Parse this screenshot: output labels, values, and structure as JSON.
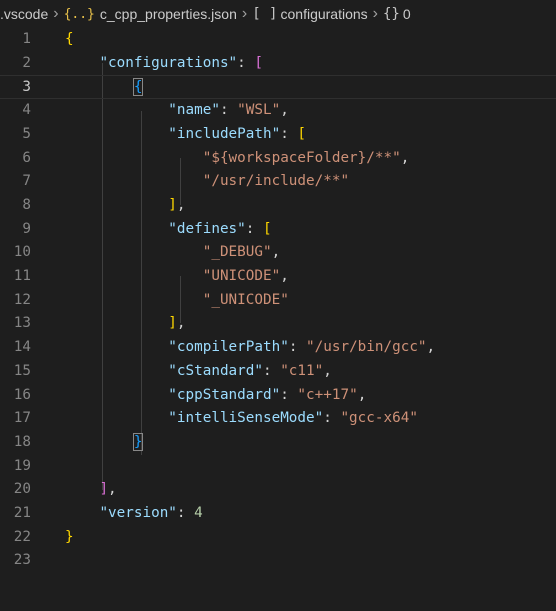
{
  "breadcrumb": {
    "folder": ".vscode",
    "file_icon": "{..}",
    "file": "c_cpp_properties.json",
    "array_icon": "[ ]",
    "array_label": "configurations",
    "object_icon": "{}",
    "object_label": "0"
  },
  "editor": {
    "current_line": 3,
    "lines": [
      {
        "n": "1",
        "tokens": [
          {
            "t": "{",
            "c": "br1"
          }
        ]
      },
      {
        "n": "2",
        "tokens": [
          {
            "t": "    "
          },
          {
            "t": "\"configurations\"",
            "c": "key"
          },
          {
            "t": ": "
          },
          {
            "t": "[",
            "c": "br2"
          }
        ]
      },
      {
        "n": "3",
        "tokens": [
          {
            "t": "        "
          },
          {
            "t": "{",
            "c": "br3 bracket-box"
          }
        ]
      },
      {
        "n": "4",
        "tokens": [
          {
            "t": "            "
          },
          {
            "t": "\"name\"",
            "c": "key"
          },
          {
            "t": ": "
          },
          {
            "t": "\"WSL\"",
            "c": "str"
          },
          {
            "t": ","
          }
        ]
      },
      {
        "n": "5",
        "tokens": [
          {
            "t": "            "
          },
          {
            "t": "\"includePath\"",
            "c": "key"
          },
          {
            "t": ": "
          },
          {
            "t": "[",
            "c": "br1"
          }
        ]
      },
      {
        "n": "6",
        "tokens": [
          {
            "t": "                "
          },
          {
            "t": "\"${workspaceFolder}/**\"",
            "c": "str"
          },
          {
            "t": ","
          }
        ]
      },
      {
        "n": "7",
        "tokens": [
          {
            "t": "                "
          },
          {
            "t": "\"/usr/include/**\"",
            "c": "str"
          }
        ]
      },
      {
        "n": "8",
        "tokens": [
          {
            "t": "            "
          },
          {
            "t": "]",
            "c": "br1"
          },
          {
            "t": ","
          }
        ]
      },
      {
        "n": "9",
        "tokens": [
          {
            "t": "            "
          },
          {
            "t": "\"defines\"",
            "c": "key"
          },
          {
            "t": ": "
          },
          {
            "t": "[",
            "c": "br1"
          }
        ]
      },
      {
        "n": "10",
        "tokens": [
          {
            "t": "                "
          },
          {
            "t": "\"_DEBUG\"",
            "c": "str"
          },
          {
            "t": ","
          }
        ]
      },
      {
        "n": "11",
        "tokens": [
          {
            "t": "                "
          },
          {
            "t": "\"UNICODE\"",
            "c": "str"
          },
          {
            "t": ","
          }
        ]
      },
      {
        "n": "12",
        "tokens": [
          {
            "t": "                "
          },
          {
            "t": "\"_UNICODE\"",
            "c": "str"
          }
        ]
      },
      {
        "n": "13",
        "tokens": [
          {
            "t": "            "
          },
          {
            "t": "]",
            "c": "br1"
          },
          {
            "t": ","
          }
        ]
      },
      {
        "n": "14",
        "tokens": [
          {
            "t": "            "
          },
          {
            "t": "\"compilerPath\"",
            "c": "key"
          },
          {
            "t": ": "
          },
          {
            "t": "\"/usr/bin/gcc\"",
            "c": "str"
          },
          {
            "t": ","
          }
        ]
      },
      {
        "n": "15",
        "tokens": [
          {
            "t": "            "
          },
          {
            "t": "\"cStandard\"",
            "c": "key"
          },
          {
            "t": ": "
          },
          {
            "t": "\"c11\"",
            "c": "str"
          },
          {
            "t": ","
          }
        ]
      },
      {
        "n": "16",
        "tokens": [
          {
            "t": "            "
          },
          {
            "t": "\"cppStandard\"",
            "c": "key"
          },
          {
            "t": ": "
          },
          {
            "t": "\"c++17\"",
            "c": "str"
          },
          {
            "t": ","
          }
        ]
      },
      {
        "n": "17",
        "tokens": [
          {
            "t": "            "
          },
          {
            "t": "\"intelliSenseMode\"",
            "c": "key"
          },
          {
            "t": ": "
          },
          {
            "t": "\"gcc-x64\"",
            "c": "str"
          }
        ]
      },
      {
        "n": "18",
        "tokens": [
          {
            "t": "        "
          },
          {
            "t": "}",
            "c": "br3 bracket-box"
          }
        ]
      },
      {
        "n": "19",
        "tokens": []
      },
      {
        "n": "20",
        "tokens": [
          {
            "t": "    "
          },
          {
            "t": "]",
            "c": "br2"
          },
          {
            "t": ","
          }
        ]
      },
      {
        "n": "21",
        "tokens": [
          {
            "t": "    "
          },
          {
            "t": "\"version\"",
            "c": "key"
          },
          {
            "t": ": "
          },
          {
            "t": "4",
            "c": "num"
          }
        ]
      },
      {
        "n": "22",
        "tokens": [
          {
            "t": "}",
            "c": "br1"
          }
        ]
      },
      {
        "n": "23",
        "tokens": []
      }
    ]
  },
  "colors": {
    "background": "#1e1e1e",
    "key": "#9cdcfe",
    "string": "#ce9178",
    "number": "#b5cea8",
    "bracket_level1": "#ffd700",
    "bracket_level2": "#da70d6",
    "bracket_level3": "#179fff"
  }
}
